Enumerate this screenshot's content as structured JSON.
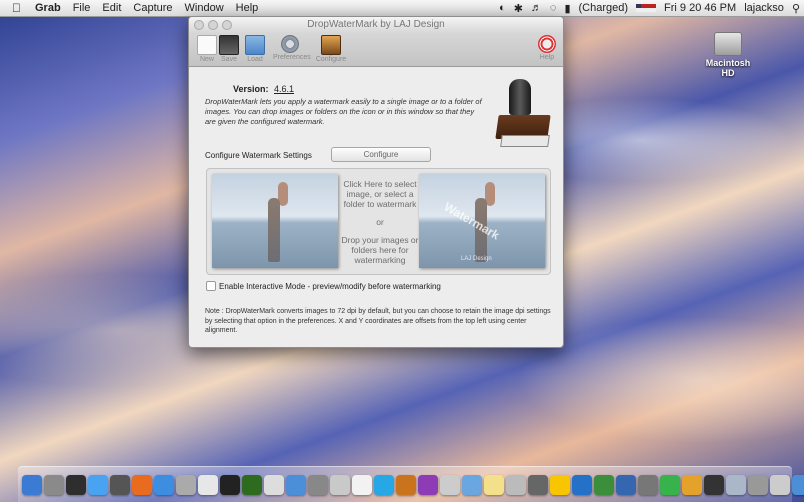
{
  "menubar": {
    "apple": "",
    "app": "Grab",
    "items": [
      "File",
      "Edit",
      "Capture",
      "Window",
      "Help"
    ],
    "battery": "(Charged)",
    "clock": "Fri 9 20 46 PM",
    "user": "lajackso"
  },
  "desktop": {
    "disk_label": "Macintosh HD"
  },
  "window": {
    "title": "DropWaterMark by LAJ Design",
    "toolbar": {
      "new": "New",
      "save": "Save",
      "load": "Load",
      "preferences": "Preferences",
      "configure": "Configure",
      "help": "Help"
    },
    "version_label": "Version:",
    "version_value": "4.6.1",
    "description": "DropWaterMark lets you apply a watermark easily to a single image or to a folder of images. You can drop images or folders on the icon or in this window so that they are given the configured watermark.",
    "configure_label": "Configure Watermark Settings",
    "configure_button": "Configure",
    "drop": {
      "line1": "Click Here to select image, or select a folder to watermark",
      "or": "or",
      "line2": "Drop your images or folders here for watermarking",
      "watermark_text": "Watermark",
      "watermark_credit": "LAJ Design"
    },
    "interactive_label": "Enable Interactive Mode - preview/modify before watermarking",
    "interactive_checked": false,
    "note": "Note : DropWaterMark converts images to 72 dpi by default, but you can choose to retain the image dpi settings by selecting that option in the preferences. X and Y coordinates are offsets from the top left using center alignment."
  },
  "dock": {
    "icons": [
      "finder-icon",
      "launchpad-icon",
      "dashboard-icon",
      "app-store-icon",
      "system-icon",
      "firefox-icon",
      "safari-icon",
      "preview-icon",
      "chrome-icon",
      "terminal-icon",
      "dreamweaver-icon",
      "calendar-icon",
      "itunes-icon",
      "photo-icon",
      "text-icon",
      "crossword-icon",
      "skype-icon",
      "guitar-icon",
      "app-icon",
      "spider-icon",
      "mail-icon",
      "notes-icon",
      "grab-icon",
      "utility-icon",
      "duck-icon",
      "dropbox-icon",
      "image-icon",
      "xcode-icon",
      "preview2-icon",
      "green-cube-icon",
      "pie-icon",
      "stamp-icon",
      "folder-icon",
      "drive-icon",
      "camera-icon",
      "download-icon",
      "trash-icon"
    ],
    "colors": [
      "#3b7bd4",
      "#8a8a8a",
      "#2e2e2e",
      "#4aa3f0",
      "#555",
      "#e86b1f",
      "#3d8de0",
      "#aaa",
      "#e7e7e7",
      "#222",
      "#2f6b1f",
      "#ddd",
      "#4b8fd8",
      "#888",
      "#c9c9c9",
      "#f2f2f2",
      "#27a7e6",
      "#c9731c",
      "#8e3cb6",
      "#ccc",
      "#6aa6e0",
      "#f4e08a",
      "#bbb",
      "#666",
      "#f7c600",
      "#2472c8",
      "#3b8f3b",
      "#3467b0",
      "#777",
      "#38b24a",
      "#e4a22b",
      "#333",
      "#a9b7c9",
      "#999",
      "#ccc",
      "#4d8fd6",
      "#999"
    ]
  }
}
